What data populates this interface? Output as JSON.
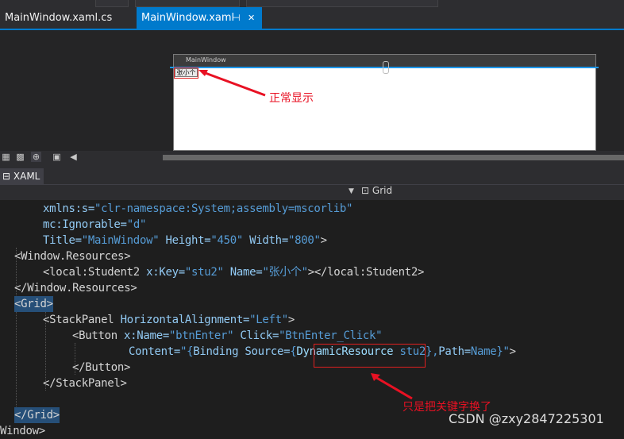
{
  "tabs": [
    {
      "label": "MainWindow.xaml.cs"
    },
    {
      "label": "MainWindow.xaml",
      "pin_icon": "pin-icon",
      "close_icon": "close-icon"
    }
  ],
  "designer": {
    "window_title": "MainWindow",
    "button_text": "张小个",
    "annotation": "正常显示"
  },
  "xaml_tab": "XAML",
  "nav": {
    "element": "Grid"
  },
  "code_lines": [
    "xmlns:s=\"clr-namespace:System;assembly=mscorlib\"",
    "mc:Ignorable=\"d\"",
    "Title=\"MainWindow\" Height=\"450\" Width=\"800\">",
    "<Window.Resources>",
    "<local:Student2 x:Key=\"stu2\" Name=\"张小个\"></local:Student2>",
    "</Window.Resources>",
    "<Grid>",
    "<StackPanel HorizontalAlignment=\"Left\">",
    "<Button x:Name=\"btnEnter\" Click=\"BtnEnter_Click\"",
    "Content=\"{Binding Source={DynamicResource stu2},Path=Name}\">",
    "</Button>",
    "</StackPanel>",
    "",
    "</Grid>",
    "Window>"
  ],
  "annotation_2": "只是把关键字换了",
  "watermark": "CSDN @zxy2847225301",
  "colors": {
    "accent": "#007acc",
    "annotation": "#e81123"
  }
}
